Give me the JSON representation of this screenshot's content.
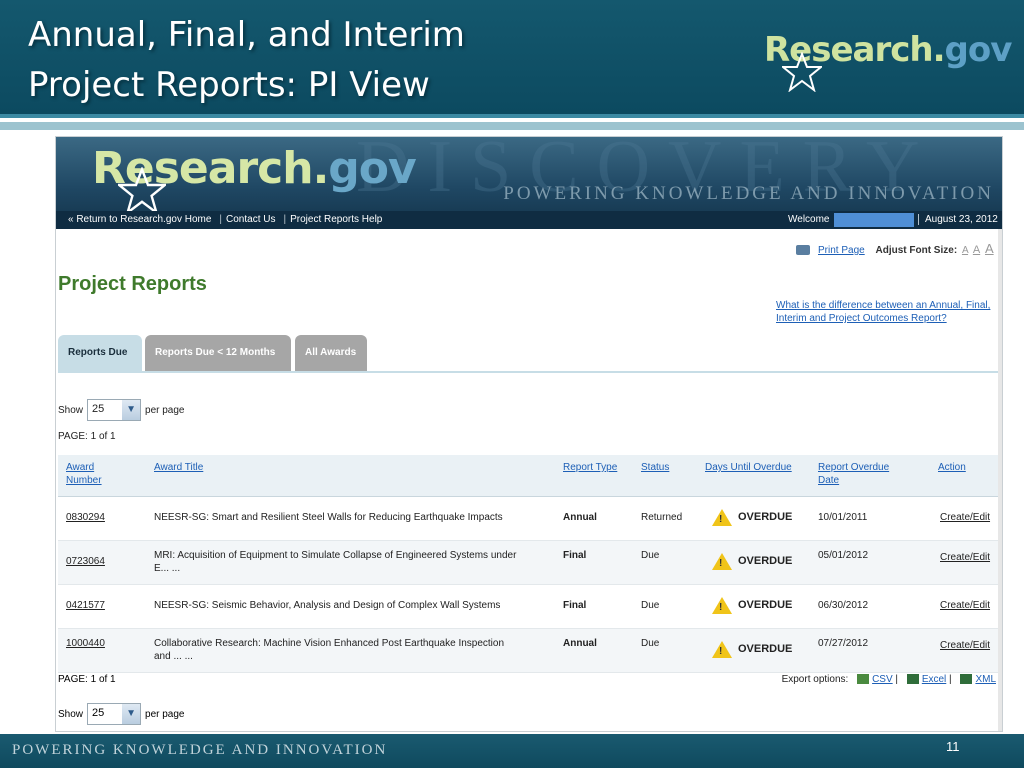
{
  "slide": {
    "title_line1": "Annual, Final, and Interim",
    "title_line2": "Project Reports: PI View",
    "logo_research": "Research",
    "logo_dot": ".",
    "logo_gov": "gov",
    "footer": "POWERING KNOWLEDGE AND INNOVATION",
    "page_number": "11"
  },
  "site": {
    "logo_research": "Research",
    "logo_dot": ".",
    "logo_gov": "gov",
    "tagline": "POWERING KNOWLEDGE AND INNOVATION",
    "banner_watermark": "DISCOVERY",
    "nav": {
      "home": "« Return to Research.gov Home",
      "contact": "Contact Us",
      "help": "Project Reports Help",
      "welcome": "Welcome",
      "date": "August 23, 2012"
    },
    "utility": {
      "print": "Print Page",
      "font_size_label": "Adjust Font Size:",
      "font_a1": "A",
      "font_a2": "A",
      "font_a3": "A"
    }
  },
  "page": {
    "title": "Project Reports",
    "help_link": "What is the difference between an Annual, Final, Interim and Project Outcomes Report?",
    "tabs": [
      {
        "label": "Reports Due"
      },
      {
        "label": "Reports Due < 12 Months"
      },
      {
        "label": "All Awards"
      }
    ],
    "show_label": "Show",
    "per_page_value": "25",
    "per_page_label": "per page",
    "page_count": "PAGE: 1 of 1"
  },
  "table": {
    "headers": {
      "award_number_1": "Award",
      "award_number_2": "Number",
      "award_title": "Award Title",
      "report_type": "Report Type",
      "status": "Status",
      "days": "Days Until Overdue",
      "overdue_date_1": "Report Overdue",
      "overdue_date_2": "Date",
      "action": "Action"
    },
    "rows": [
      {
        "award": "0830294",
        "title": "NEESR-SG: Smart and Resilient Steel Walls for Reducing Earthquake Impacts",
        "title2": "",
        "type": "Annual",
        "status": "Returned",
        "days": "OVERDUE",
        "date": "10/01/2011",
        "action": "Create/Edit"
      },
      {
        "award": "0723064",
        "title": "MRI: Acquisition of Equipment to Simulate Collapse of Engineered Systems under",
        "title2": "E... ...",
        "type": "Final",
        "status": "Due",
        "days": "OVERDUE",
        "date": "05/01/2012",
        "action": "Create/Edit"
      },
      {
        "award": "0421577",
        "title": "NEESR-SG: Seismic Behavior, Analysis and Design of Complex Wall Systems",
        "title2": "",
        "type": "Final",
        "status": "Due",
        "days": "OVERDUE",
        "date": "06/30/2012",
        "action": "Create/Edit"
      },
      {
        "award": "1000440",
        "title": "Collaborative Research: Machine Vision Enhanced Post Earthquake Inspection",
        "title2": "and ... ...",
        "type": "Annual",
        "status": "Due",
        "days": "OVERDUE",
        "date": "07/27/2012",
        "action": "Create/Edit"
      }
    ],
    "warning_mark": "!"
  },
  "export": {
    "label": "Export options:",
    "csv": "CSV",
    "excel": "Excel",
    "xml": "XML",
    "sep": "|"
  }
}
